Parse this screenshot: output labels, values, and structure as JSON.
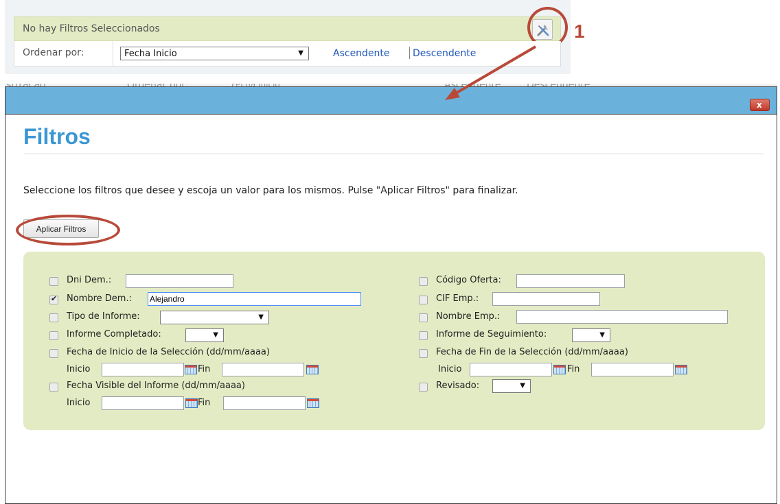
{
  "top": {
    "no_filters_msg": "No hay Filtros Seleccionados",
    "order_label": "Ordenar por:",
    "order_value": "Fecha Inicio",
    "ascending": "Ascendente",
    "descending": "Descendente",
    "annotation_number": "1"
  },
  "background": {
    "frag_a": "strração",
    "frag_order": "Ordenar por:",
    "frag_value": "Fecha Inicio",
    "frag_asc": "Ascendente",
    "frag_desc": "Descendente"
  },
  "modal": {
    "close_label": "x",
    "title": "Filtros",
    "instructions": "Seleccione los filtros que desee y escoja un valor para los mismos. Pulse \"Aplicar Filtros\" para finalizar.",
    "apply_button": "Aplicar Filtros"
  },
  "filters_left": {
    "dni_label": "Dni Dem.:",
    "nombre_label": "Nombre Dem.:",
    "nombre_value": "Alejandro",
    "tipo_label": "Tipo de Informe:",
    "completado_label": "Informe Completado:",
    "fecha_inicio_label": "Fecha de Inicio de la Selección (dd/mm/aaaa)",
    "fecha_visible_label": "Fecha Visible del Informe (dd/mm/aaaa)",
    "inicio": "Inicio",
    "fin": "Fin"
  },
  "filters_right": {
    "codigo_label": "Código Oferta:",
    "cif_label": "CIF Emp.:",
    "nombre_emp_label": "Nombre Emp.:",
    "seguimiento_label": "Informe de Seguimiento:",
    "fecha_fin_label": "Fecha de Fin de la Selección (dd/mm/aaaa)",
    "revisado_label": "Revisado:",
    "inicio": "Inicio",
    "fin": "Fin"
  },
  "colors": {
    "annotation": "#b84a3a",
    "title_bar": "#6ab2db",
    "heading": "#3b97d3",
    "panel_green": "#e3ebc4",
    "link": "#2058b8"
  },
  "icons": [
    "wrench-screwdriver-icon",
    "close-icon",
    "calendar-icon",
    "checkbox-checked-icon"
  ]
}
